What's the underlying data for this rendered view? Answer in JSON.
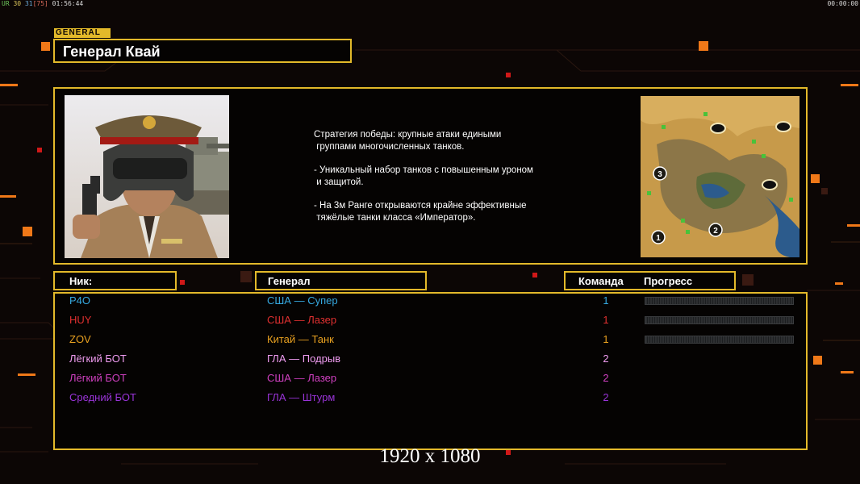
{
  "hud": {
    "left": {
      "fps_label": "UR",
      "fps_a": "30",
      "fps_b": "31",
      "fps_c": "[75]",
      "clock": "01:56:44"
    },
    "right": "00:00:00"
  },
  "general_tab": "GENERAL",
  "general_name": "Генерал Квай",
  "strategy_lines": [
    "Стратегия победы: крупные атаки едиными",
    " группами многочисленных танков.",
    "",
    "- Уникальный набор танков с повышенным уроном",
    " и защитой.",
    "",
    "- На 3м Ранге открываются крайне эффективные",
    " тяжёлые танки класса «Император»."
  ],
  "minimap": {
    "start_positions": [
      "1",
      "2",
      "3"
    ]
  },
  "columns": {
    "nick": "Ник:",
    "general": "Генерал",
    "team": "Команда",
    "progress": "Прогресс"
  },
  "players": [
    {
      "nick": "P4O",
      "general": "США — Супер",
      "team": "1",
      "color": "#36a9e0",
      "progress_bar": true
    },
    {
      "nick": "HUY",
      "general": "США — Лазер",
      "team": "1",
      "color": "#e03030",
      "progress_bar": true
    },
    {
      "nick": "ZOV",
      "general": "Китай — Танк",
      "team": "1",
      "color": "#e8a020",
      "progress_bar": true
    },
    {
      "nick": "Лёгкий БОТ",
      "general": "ГЛА — Подрыв",
      "team": "2",
      "color": "#f09cf0",
      "progress_bar": false
    },
    {
      "nick": "Лёгкий БОТ",
      "general": "США — Лазер",
      "team": "2",
      "color": "#d040c0",
      "progress_bar": false
    },
    {
      "nick": "Средний БОТ",
      "general": "ГЛА — Штурм",
      "team": "2",
      "color": "#9a34d8",
      "progress_bar": false
    }
  ],
  "resolution_label": "1920 x 1080",
  "colors": {
    "accent": "#e3b92a",
    "background": "#0c0605",
    "deco_orange": "#f07818"
  }
}
